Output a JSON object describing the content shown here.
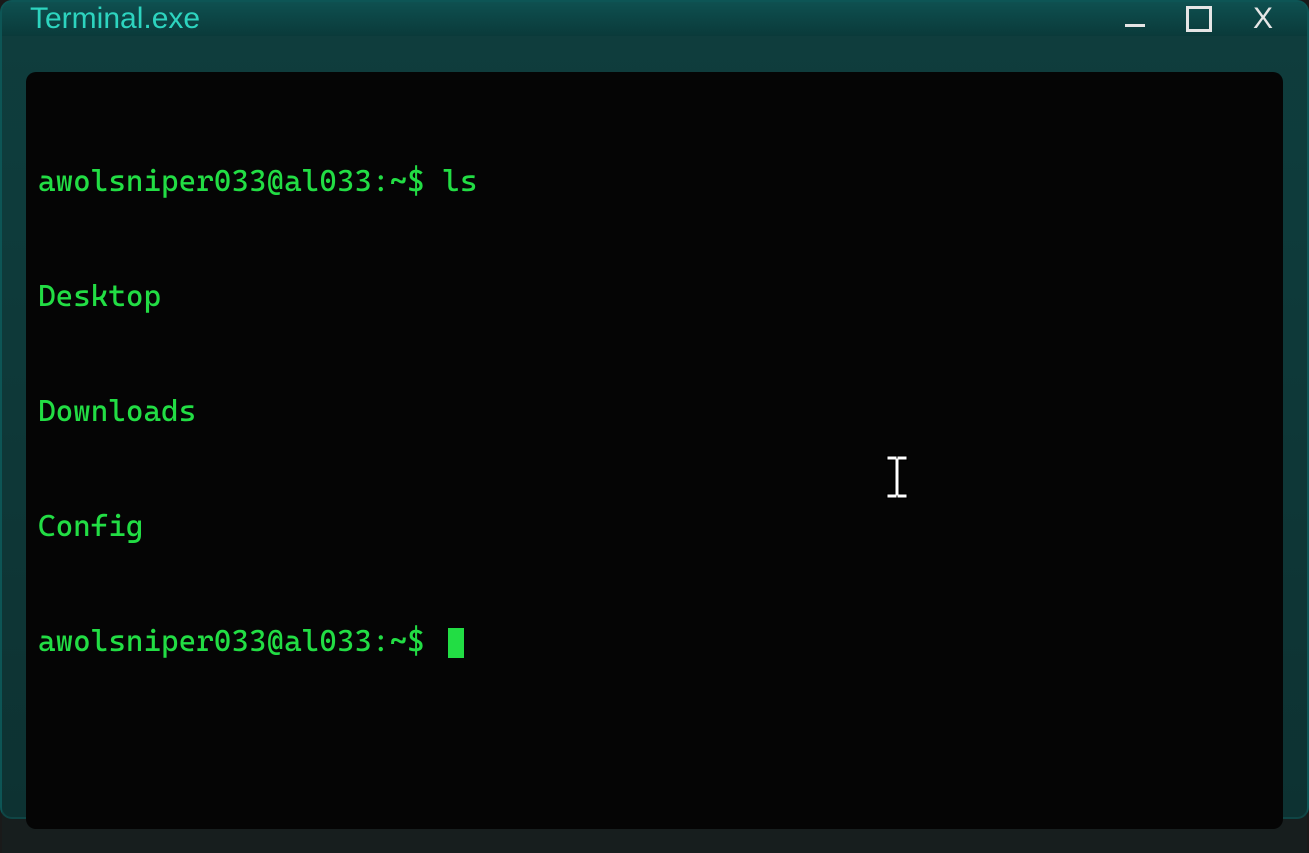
{
  "window": {
    "title": "Terminal.exe"
  },
  "terminal": {
    "prompt": "awolsniper033@al033:~$ ",
    "command": "ls",
    "output": [
      "Desktop",
      "Downloads",
      "Config"
    ],
    "prompt2": "awolsniper033@al033:~$ "
  },
  "colors": {
    "term_fg": "#22dd44",
    "term_bg": "#050505",
    "title_fg": "#2dd4bf",
    "frame_bg": "#0d4a4a"
  }
}
